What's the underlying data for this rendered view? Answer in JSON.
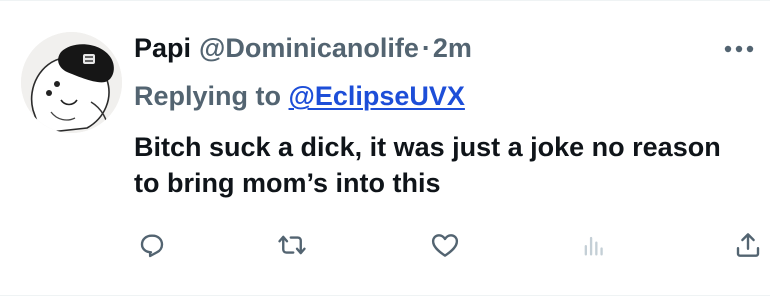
{
  "tweet": {
    "display_name": "Papi",
    "handle": "@Dominicanolife",
    "separator": "·",
    "time": "2m",
    "replying_prefix": "Replying to",
    "replying_to": "@EclipseUVX",
    "text": "Bitch suck a dick, it was just a joke no reason to bring mom’s into this"
  },
  "icons": {
    "more": "more-icon",
    "reply": "reply-icon",
    "retweet": "retweet-icon",
    "like": "like-icon",
    "views": "views-icon",
    "share": "share-icon"
  },
  "colors": {
    "primary_text": "#0f1419",
    "secondary_text": "#536471",
    "link": "#1d4ed8",
    "icon": "#536471",
    "views_icon": "#c4cfd6",
    "divider": "#eff3f4"
  }
}
